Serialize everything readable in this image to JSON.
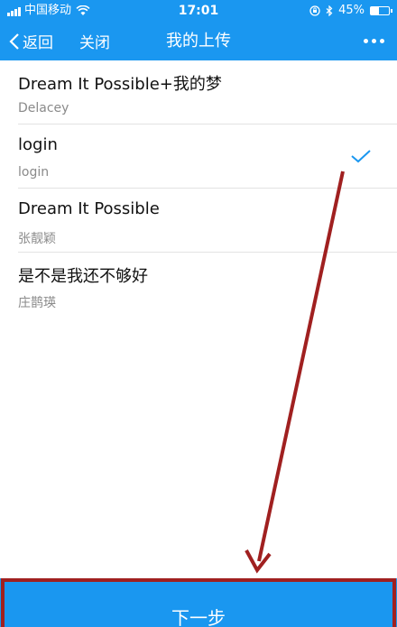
{
  "status_bar": {
    "carrier": "中国移动",
    "time": "17:01",
    "battery": "45%",
    "battery_fraction": 0.45
  },
  "nav": {
    "back_label": "返回",
    "close_label": "关闭",
    "title": "我的上传"
  },
  "uploads": [
    {
      "title": "Dream It Possible+我的梦",
      "artist": "Delacey",
      "selected": false
    },
    {
      "title": "login",
      "artist": "login",
      "selected": true
    },
    {
      "title": "Dream It Possible",
      "artist": "张靓颖",
      "selected": false
    },
    {
      "title": "是不是我还不够好",
      "artist": "庄鹊瑛",
      "selected": false
    }
  ],
  "footer": {
    "next_label": "下一步"
  },
  "colors": {
    "accent": "#1a97f0",
    "annotation": "#a02020"
  }
}
